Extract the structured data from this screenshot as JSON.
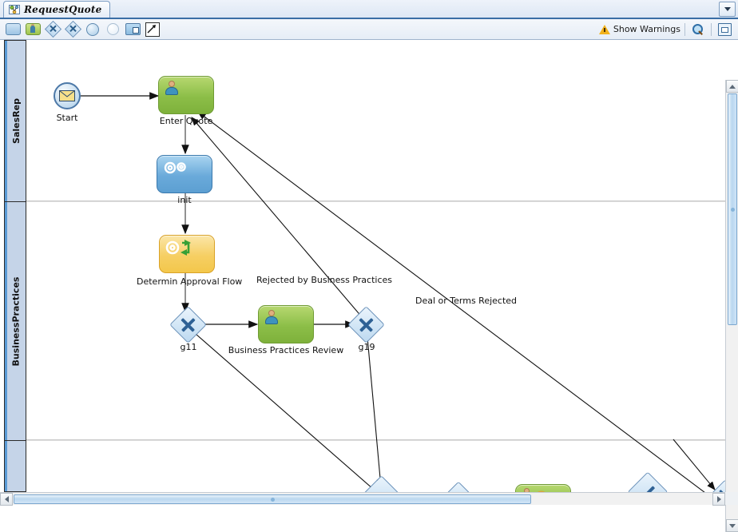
{
  "tab": {
    "label": "RequestQuote",
    "icon": "process-diagram-icon",
    "dropdown_icon": "chevron-down-icon"
  },
  "toolbar": {
    "tools": [
      {
        "name": "task-tool",
        "icon": "rounded-rectangle-icon",
        "title": "Task"
      },
      {
        "name": "user-task-tool",
        "icon": "user-task-icon",
        "title": "User Task"
      },
      {
        "name": "exclusive-gateway-tool",
        "icon": "exclusive-gateway-icon",
        "title": "Exclusive Gateway"
      },
      {
        "name": "parallel-gateway-tool",
        "icon": "parallel-gateway-icon",
        "title": "Parallel Gateway"
      },
      {
        "name": "start-event-tool",
        "icon": "start-event-icon",
        "title": "Start Event"
      },
      {
        "name": "end-event-tool",
        "icon": "end-event-icon",
        "title": "End Event"
      },
      {
        "name": "subprocess-tool",
        "icon": "subprocess-icon",
        "title": "Subprocess"
      },
      {
        "name": "sequence-flow-tool",
        "icon": "arrow-pointer-icon",
        "title": "Sequence Flow"
      }
    ],
    "show_warnings_label": "Show Warnings",
    "warning_icon": "warning-triangle-icon",
    "zoom_icon": "magnifier-icon",
    "panel_icon": "property-panel-icon"
  },
  "lanes": [
    {
      "name": "SalesRep",
      "label": "SalesRep"
    },
    {
      "name": "BusinessPractices",
      "label": "BusinessPractices"
    },
    {
      "name": "lane-third",
      "label": ""
    }
  ],
  "nodes": [
    {
      "id": "start",
      "type": "message-start-event",
      "label": "Start"
    },
    {
      "id": "enterQuote",
      "type": "user-task",
      "label": "Enter Quote"
    },
    {
      "id": "init",
      "type": "service-task",
      "label": "init"
    },
    {
      "id": "determineApprovalFlow",
      "type": "business-rule-task",
      "label": "Determin Approval Flow"
    },
    {
      "id": "g11",
      "type": "exclusive-gateway",
      "label": "g11"
    },
    {
      "id": "businessPracticesReview",
      "type": "user-task",
      "label": "Business Practices Review"
    },
    {
      "id": "g19",
      "type": "exclusive-gateway",
      "label": "g19"
    }
  ],
  "flow_labels": [
    {
      "id": "rejectedByBP",
      "text": "Rejected by Business Practices"
    },
    {
      "id": "dealOrTermsRejected",
      "text": "Deal or Terms Rejected"
    }
  ],
  "scrollbars": {
    "vertical": {
      "up_icon": "chevron-up-icon",
      "down_icon": "chevron-down-icon"
    },
    "horizontal": {
      "left_icon": "chevron-left-icon",
      "right_icon": "chevron-right-icon"
    }
  },
  "colors": {
    "user_task": "#8cbe48",
    "service_task": "#6aaada",
    "rule_task": "#f6cf63",
    "gateway": "#bdd9f0",
    "lane_header": "#c5d4e8",
    "accent": "#3a6ea5"
  }
}
